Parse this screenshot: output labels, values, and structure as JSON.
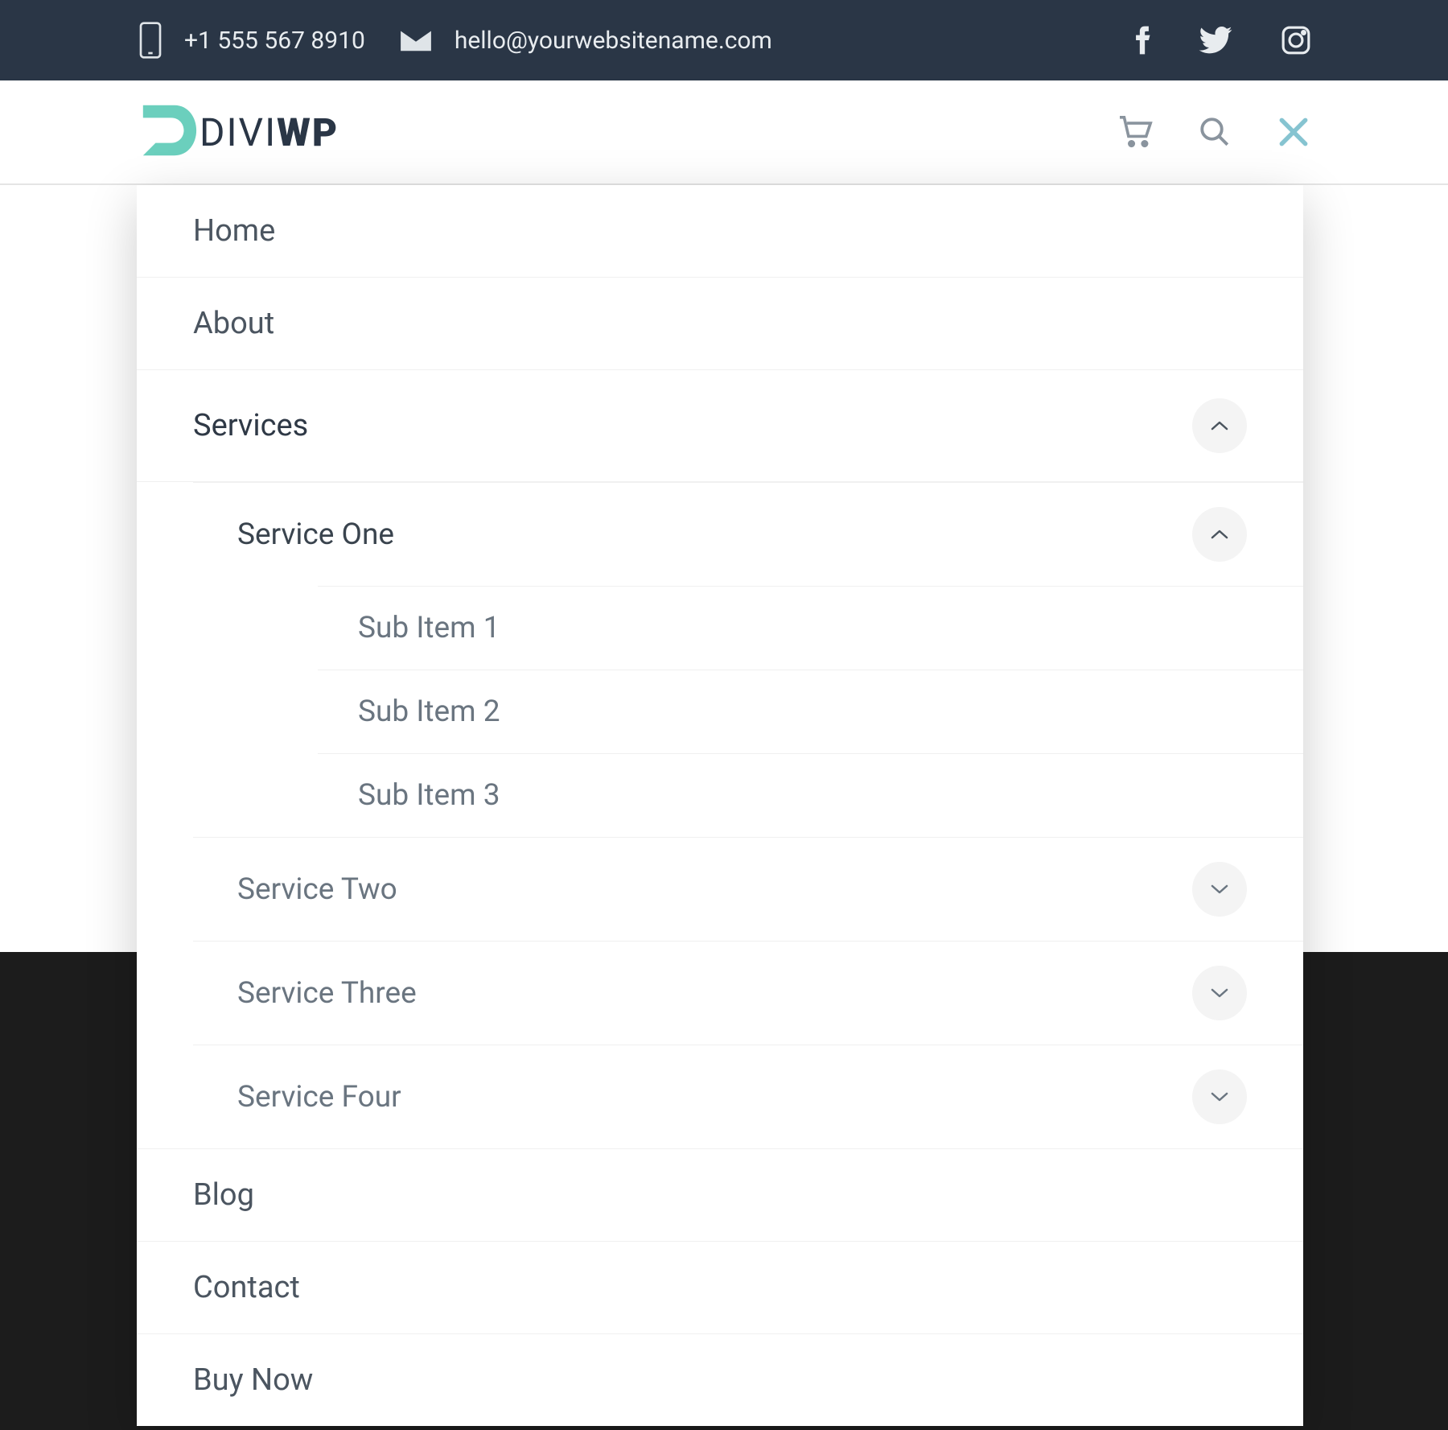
{
  "topbar": {
    "phone": "+1 555 567 8910",
    "email": "hello@yourwebsitename.com"
  },
  "logo": {
    "text1": "DIVI",
    "text2": "WP"
  },
  "menu": {
    "items": [
      {
        "label": "Home"
      },
      {
        "label": "About"
      },
      {
        "label": "Services",
        "expanded": true,
        "children": [
          {
            "label": "Service One",
            "expanded": true,
            "children": [
              {
                "label": "Sub Item 1"
              },
              {
                "label": "Sub Item 2"
              },
              {
                "label": "Sub Item 3"
              }
            ]
          },
          {
            "label": "Service Two",
            "expanded": false
          },
          {
            "label": "Service Three",
            "expanded": false
          },
          {
            "label": "Service Four",
            "expanded": false
          }
        ]
      },
      {
        "label": "Blog"
      },
      {
        "label": "Contact"
      },
      {
        "label": "Buy Now"
      }
    ]
  }
}
